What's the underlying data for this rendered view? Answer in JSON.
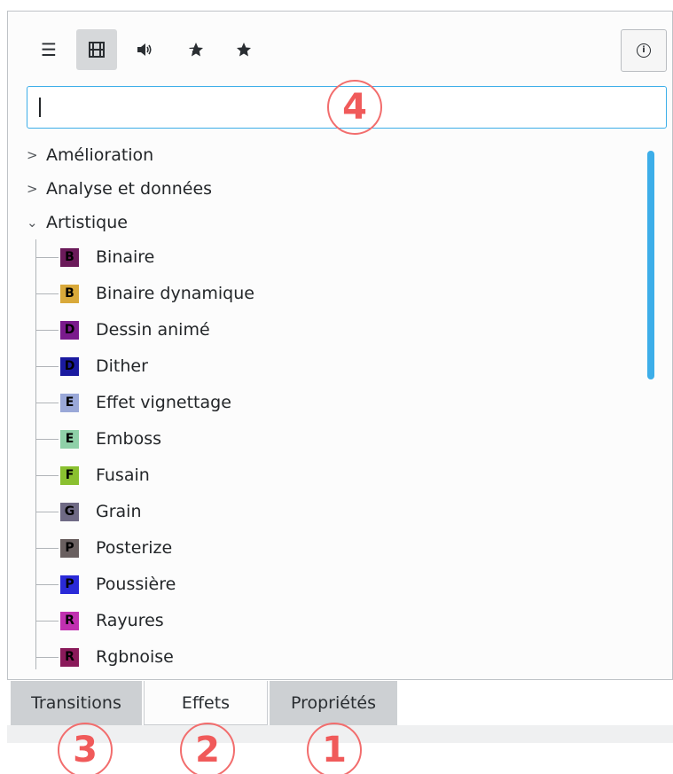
{
  "toolbar": {
    "buttons": [
      {
        "name": "list-icon",
        "glyph": "☰",
        "active": false
      },
      {
        "name": "video-icon",
        "glyph": "🎞",
        "active": true
      },
      {
        "name": "audio-icon",
        "glyph": "🔊",
        "active": false
      },
      {
        "name": "custom-star-icon",
        "glyph": "✦",
        "active": false
      },
      {
        "name": "favorite-star-icon",
        "glyph": "★",
        "active": false
      }
    ],
    "info_glyph": "i"
  },
  "search": {
    "value": "",
    "placeholder": ""
  },
  "tree": {
    "categories_collapsed": [
      {
        "label": "Amélioration"
      },
      {
        "label": "Analyse et données"
      }
    ],
    "category_open": {
      "label": "Artistique"
    },
    "items": [
      {
        "letter": "B",
        "label": "Binaire",
        "color": "#6b1a5a"
      },
      {
        "letter": "B",
        "label": "Binaire dynamique",
        "color": "#d9a93a"
      },
      {
        "letter": "D",
        "label": "Dessin animé",
        "color": "#7a1a8c"
      },
      {
        "letter": "D",
        "label": "Dither",
        "color": "#1a1aa0"
      },
      {
        "letter": "E",
        "label": "Effet vignettage",
        "color": "#9aa8d8"
      },
      {
        "letter": "E",
        "label": "Emboss",
        "color": "#8fd0a8"
      },
      {
        "letter": "F",
        "label": "Fusain",
        "color": "#8ac030"
      },
      {
        "letter": "G",
        "label": "Grain",
        "color": "#6f6a85"
      },
      {
        "letter": "P",
        "label": "Posterize",
        "color": "#6a6060"
      },
      {
        "letter": "P",
        "label": "Poussière",
        "color": "#2a2ad8"
      },
      {
        "letter": "R",
        "label": "Rayures",
        "color": "#c030b0"
      },
      {
        "letter": "R",
        "label": "Rgbnoise",
        "color": "#8a1a5a"
      }
    ]
  },
  "tabs": [
    {
      "label": "Transitions",
      "state": "inactive"
    },
    {
      "label": "Effets",
      "state": "selected"
    },
    {
      "label": "Propriétés",
      "state": "inactive"
    }
  ],
  "callouts": [
    "4",
    "3",
    "2",
    "1"
  ],
  "colors": {
    "accent": "#3daee9",
    "callout": "#f26d6d"
  }
}
